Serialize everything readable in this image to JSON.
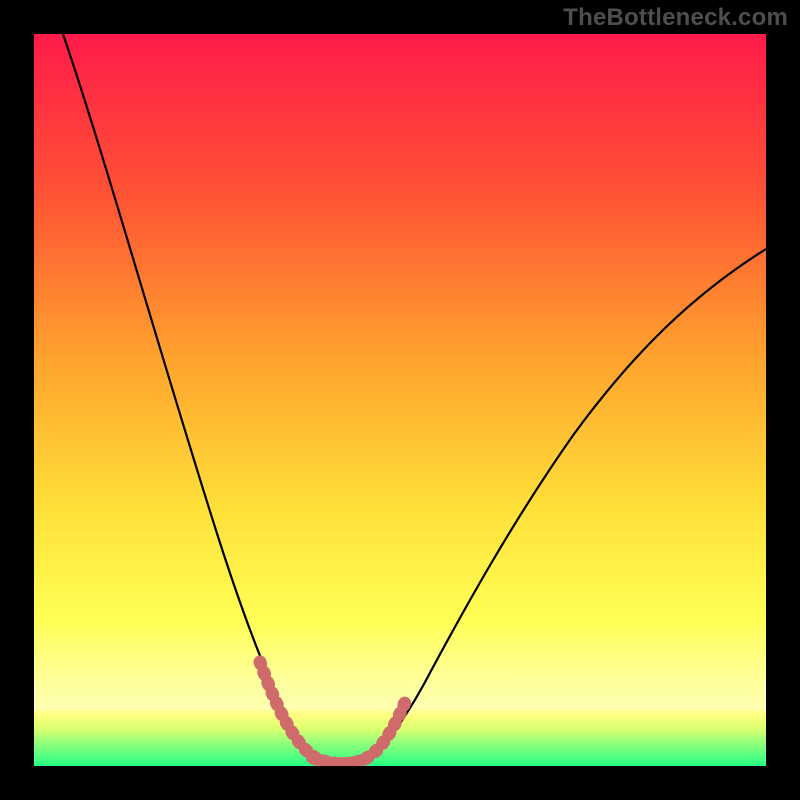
{
  "watermark": "TheBottleneck.com",
  "colors": {
    "bg_black": "#000000",
    "grad_top": "#ff1b4a",
    "grad_mid1": "#ff6e2e",
    "grad_mid2": "#ffd43a",
    "grad_mid3": "#ffff55",
    "grad_yellow_band": "#ffff99",
    "grad_bottom": "#2dff88",
    "curve": "#000000",
    "highlight": "#cf6b6b"
  },
  "chart_data": {
    "type": "line",
    "title": "",
    "xlabel": "",
    "ylabel": "",
    "xlim": [
      0,
      100
    ],
    "ylim": [
      0,
      100
    ],
    "grid": false,
    "legend": false,
    "series": [
      {
        "name": "bottleneck-curve",
        "x": [
          4,
          8,
          12,
          16,
          20,
          24,
          28,
          31,
          33.5,
          36,
          38,
          40,
          42,
          44,
          46,
          48,
          52,
          56,
          62,
          70,
          80,
          90,
          100
        ],
        "y": [
          100,
          88,
          76,
          64,
          52,
          40,
          28,
          16,
          8,
          3,
          1,
          0.5,
          0.5,
          1,
          3,
          7,
          14,
          22,
          32,
          44,
          56,
          65,
          71
        ]
      }
    ],
    "highlight_band_x": [
      30.5,
      47
    ],
    "annotations": [],
    "ticks_x": [],
    "ticks_y": []
  }
}
